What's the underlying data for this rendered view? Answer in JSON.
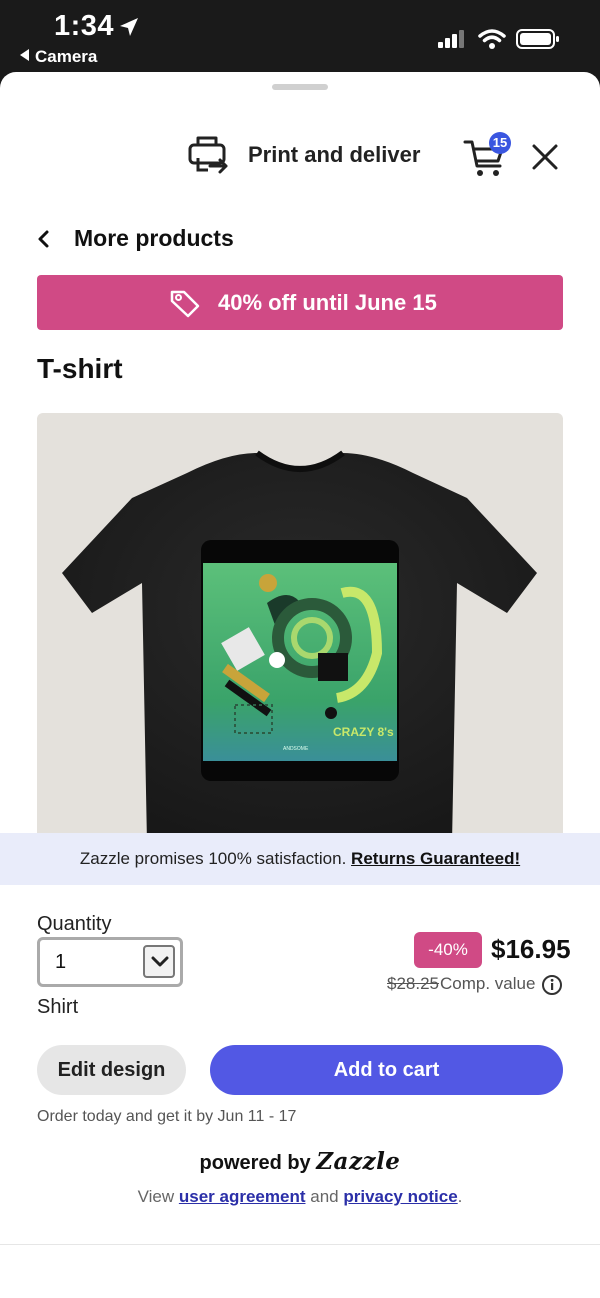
{
  "status_bar": {
    "time": "1:34",
    "back_app": "Camera"
  },
  "header": {
    "title": "Print and deliver",
    "cart_count": "15"
  },
  "nav": {
    "back_label": "More products"
  },
  "promo": {
    "text": "40% off until June 15",
    "color": "#d04a85"
  },
  "product": {
    "title": "T-shirt",
    "design_text": "CRAZY 8's",
    "design_small_text": "ANDSOME"
  },
  "satisfaction": {
    "text": "Zazzle promises 100% satisfaction.",
    "link": "Returns Guaranteed!"
  },
  "purchase": {
    "quantity_label": "Quantity",
    "quantity_value": "1",
    "variant_label": "Shirt",
    "discount_badge": "-40%",
    "price": "$16.95",
    "original_price": "$28.25",
    "comp_label": "Comp. value"
  },
  "actions": {
    "edit_label": "Edit design",
    "add_label": "Add to cart",
    "accent": "#5258e4"
  },
  "delivery": {
    "note": "Order today and get it by Jun 11 - 17"
  },
  "footer": {
    "powered_prefix": "powered by",
    "brand": "Zazzle",
    "legal_prefix": "View",
    "user_agreement": "user agreement",
    "and": "and",
    "privacy_notice": "privacy notice",
    "period": "."
  }
}
